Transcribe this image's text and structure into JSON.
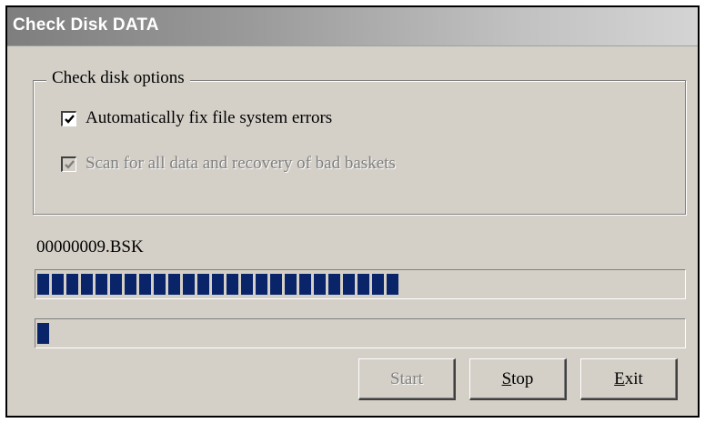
{
  "window": {
    "title": "Check Disk DATA"
  },
  "options": {
    "group_label": "Check disk options",
    "items": [
      {
        "label": "Automatically fix file system errors",
        "checked": true,
        "enabled": true
      },
      {
        "label": "Scan for all data and recovery of bad baskets",
        "checked": true,
        "enabled": false
      }
    ]
  },
  "status": {
    "current_file": "00000009.BSK"
  },
  "progress": {
    "overall_percent": 56,
    "current_percent": 2
  },
  "buttons": {
    "start": {
      "label": "Start",
      "enabled": false
    },
    "stop": {
      "mnemonic": "S",
      "rest": "top",
      "enabled": true
    },
    "exit": {
      "mnemonic": "E",
      "rest": "xit",
      "enabled": true
    }
  },
  "colors": {
    "progress_fill": "#0a246a",
    "dialog_face": "#d4d0c8"
  },
  "icons": {
    "checkmark": "check-icon"
  }
}
